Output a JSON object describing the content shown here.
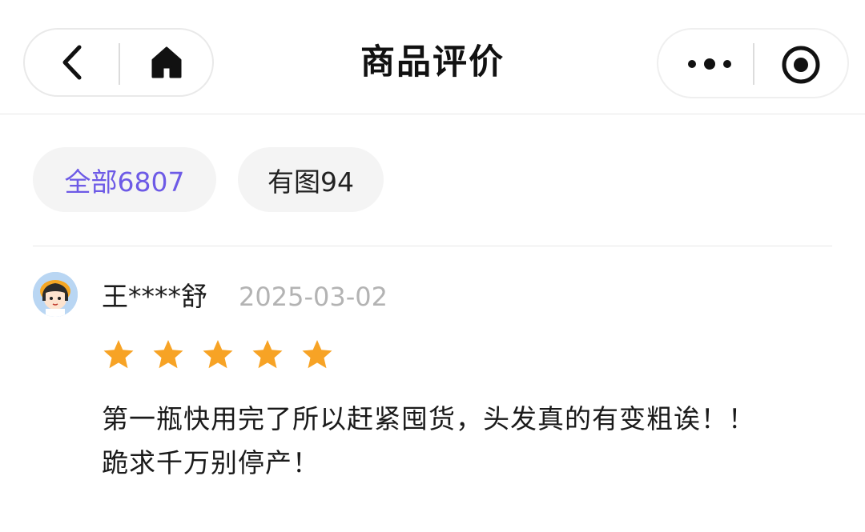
{
  "header": {
    "title": "商品评价",
    "icons": {
      "back": "back-arrow-icon",
      "home": "home-icon",
      "more": "more-dots-icon",
      "close": "record-target-icon"
    }
  },
  "filters": {
    "all_label": "全部6807",
    "photo_label": "有图94",
    "active": "all",
    "active_color": "#6d5ae6"
  },
  "review": {
    "avatar_icon": "cartoon-girl-avatar",
    "user_name": "王****舒",
    "date": "2025-03-02",
    "rating": 5,
    "rating_max": 5,
    "star_color": "#f7a325",
    "text_line1": "第一瓶快用完了所以赶紧囤货，头发真的有变粗诶！！",
    "text_line2": "跪求千万别停产！"
  }
}
